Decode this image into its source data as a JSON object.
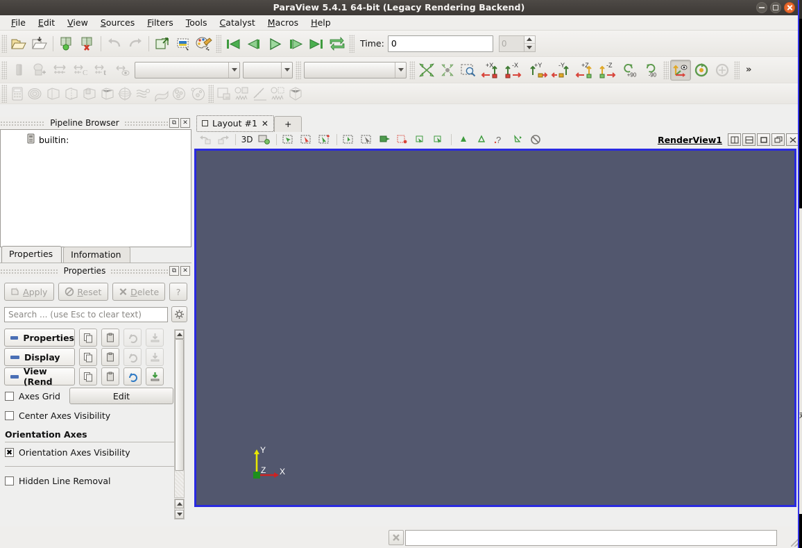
{
  "window": {
    "title": "ParaView 5.4.1 64-bit (Legacy Rendering Backend)",
    "minimize_label": "minimize-icon",
    "maximize_label": "maximize-icon",
    "close_label": "close-icon"
  },
  "menubar": {
    "items": [
      {
        "label": "File",
        "mnemonic": "F"
      },
      {
        "label": "Edit",
        "mnemonic": "E"
      },
      {
        "label": "View",
        "mnemonic": "V"
      },
      {
        "label": "Sources",
        "mnemonic": "S"
      },
      {
        "label": "Filters",
        "mnemonic": "F"
      },
      {
        "label": "Tools",
        "mnemonic": "T"
      },
      {
        "label": "Catalyst",
        "mnemonic": "C"
      },
      {
        "label": "Macros",
        "mnemonic": "M"
      },
      {
        "label": "Help",
        "mnemonic": "H"
      }
    ]
  },
  "toolbars": {
    "main": {
      "buttons": [
        {
          "name": "open-file-icon",
          "tip": "Open"
        },
        {
          "name": "recent-files-icon",
          "tip": "Recent Files"
        },
        {
          "name": "save-state-icon",
          "tip": "Save State"
        },
        {
          "name": "load-state-icon",
          "tip": "Load State"
        },
        {
          "name": "undo-icon",
          "tip": "Undo"
        },
        {
          "name": "redo-icon",
          "tip": "Redo"
        },
        {
          "name": "connect-server-icon",
          "tip": "Connect"
        },
        {
          "name": "screenshot-icon",
          "tip": "Save Screenshot"
        },
        {
          "name": "color-palette-icon",
          "tip": "Edit Color Palette"
        }
      ]
    },
    "vcr": {
      "buttons": [
        {
          "name": "first-frame-icon",
          "tip": "First Frame"
        },
        {
          "name": "previous-frame-icon",
          "tip": "Previous Frame"
        },
        {
          "name": "play-icon",
          "tip": "Play"
        },
        {
          "name": "next-frame-icon",
          "tip": "Next Frame"
        },
        {
          "name": "last-frame-icon",
          "tip": "Last Frame"
        },
        {
          "name": "loop-icon",
          "tip": "Loop"
        }
      ]
    },
    "time": {
      "label": "Time:",
      "value": "0",
      "frame_index": "0",
      "frame_enabled": false
    },
    "representation": {
      "active_array": "",
      "array_component": "",
      "representation_type": "",
      "buttons": [
        {
          "name": "solid-color-icon",
          "tip": "Solid Color"
        },
        {
          "name": "edit-color-map-icon",
          "tip": "Edit Color Map"
        },
        {
          "name": "rescale-to-data-range-icon",
          "tip": "Rescale to Data Range"
        },
        {
          "name": "rescale-custom-range-icon",
          "tip": "Rescale to Custom Range"
        },
        {
          "name": "rescale-over-time-icon",
          "tip": "Rescale over Time"
        },
        {
          "name": "rescale-visible-range-icon",
          "tip": "Rescale to Visible Range"
        }
      ]
    },
    "camera": {
      "buttons": [
        {
          "name": "reset-camera-icon",
          "tip": "Reset Camera"
        },
        {
          "name": "zoom-to-data-icon",
          "tip": "Zoom to Data"
        },
        {
          "name": "rubber-band-zoom-icon",
          "tip": "Rubber Band Zoom"
        }
      ],
      "axis_buttons": [
        {
          "name": "camera-plus-x-icon",
          "label": "+X"
        },
        {
          "name": "camera-minus-x-icon",
          "label": "-X"
        },
        {
          "name": "camera-plus-y-icon",
          "label": "+Y"
        },
        {
          "name": "camera-minus-y-icon",
          "label": "-Y"
        },
        {
          "name": "camera-plus-z-icon",
          "label": "+Z"
        },
        {
          "name": "camera-minus-z-icon",
          "label": "-Z"
        }
      ],
      "rotate_buttons": [
        {
          "name": "rotate-plus-90-icon",
          "label": "+90"
        },
        {
          "name": "rotate-minus-90-icon",
          "label": "-90"
        }
      ],
      "mode_buttons": [
        {
          "name": "show-center-axes-icon",
          "active": true
        },
        {
          "name": "reset-center-icon",
          "active": false
        },
        {
          "name": "pick-center-icon",
          "active": false
        }
      ],
      "overflow_label": "»"
    },
    "filters": {
      "buttons": [
        {
          "name": "calculator-filter-icon",
          "tip": "Calculator"
        },
        {
          "name": "contour-filter-icon",
          "tip": "Contour"
        },
        {
          "name": "clip-filter-icon",
          "tip": "Clip"
        },
        {
          "name": "slice-filter-icon",
          "tip": "Slice"
        },
        {
          "name": "threshold-filter-icon",
          "tip": "Threshold"
        },
        {
          "name": "extract-subset-filter-icon",
          "tip": "Extract Subset"
        },
        {
          "name": "glyph-filter-icon",
          "tip": "Glyph"
        },
        {
          "name": "stream-tracer-filter-icon",
          "tip": "Stream Tracer"
        },
        {
          "name": "warp-filter-icon",
          "tip": "Warp By Vector"
        },
        {
          "name": "group-datasets-filter-icon",
          "tip": "Group Datasets"
        },
        {
          "name": "extract-level-filter-icon",
          "tip": "Extract Level"
        }
      ],
      "data_buttons": [
        {
          "name": "spreadsheet-view-icon",
          "tip": "Spreadsheet View"
        },
        {
          "name": "plot-over-time-icon",
          "tip": "Plot Data Over Time"
        },
        {
          "name": "plot-over-line-icon",
          "tip": "Plot Over Line"
        },
        {
          "name": "plot-selection-over-time-icon",
          "tip": "Plot Selection Over Time"
        },
        {
          "name": "extract-block-icon",
          "tip": "Extract Block"
        }
      ]
    }
  },
  "pipeline_browser": {
    "title": "Pipeline Browser",
    "undock_label": "undock-icon",
    "close_label": "close-icon",
    "items": [
      {
        "label": "builtin:",
        "icon": "server-icon"
      }
    ]
  },
  "properties_panel": {
    "tabs": [
      {
        "label": "Properties",
        "active": true
      },
      {
        "label": "Information",
        "active": false
      }
    ],
    "title": "Properties",
    "undock_label": "undock-icon",
    "close_label": "close-icon",
    "buttons": [
      {
        "label": "Apply",
        "mnemonic": "A",
        "name": "apply-button",
        "enabled": false
      },
      {
        "label": "Reset",
        "mnemonic": "R",
        "name": "reset-button",
        "enabled": false
      },
      {
        "label": "Delete",
        "mnemonic": "D",
        "name": "delete-button",
        "enabled": false
      }
    ],
    "help_label": "?",
    "search": {
      "placeholder": "Search ... (use Esc to clear text)",
      "value": ""
    },
    "gear_label": "gear-icon",
    "sections": [
      {
        "label": "Properties",
        "name": "section-properties",
        "actions": [
          {
            "name": "copy-properties-icon",
            "enabled": true
          },
          {
            "name": "paste-properties-icon",
            "enabled": true
          },
          {
            "name": "restore-defaults-icon",
            "enabled": false
          },
          {
            "name": "save-as-defaults-icon",
            "enabled": false
          }
        ]
      },
      {
        "label": "Display",
        "name": "section-display",
        "actions": [
          {
            "name": "copy-properties-icon",
            "enabled": true
          },
          {
            "name": "paste-properties-icon",
            "enabled": true
          },
          {
            "name": "restore-defaults-icon",
            "enabled": false
          },
          {
            "name": "save-as-defaults-icon",
            "enabled": false
          }
        ]
      },
      {
        "label": "View (Rend",
        "name": "section-view",
        "actions": [
          {
            "name": "copy-properties-icon",
            "enabled": true
          },
          {
            "name": "paste-properties-icon",
            "enabled": true
          },
          {
            "name": "restore-defaults-icon",
            "enabled": true
          },
          {
            "name": "save-as-defaults-icon",
            "enabled": true
          }
        ]
      }
    ],
    "view_properties": {
      "axes_grid": {
        "label": "Axes Grid",
        "checked": false,
        "edit_label": "Edit"
      },
      "center_axes_visibility": {
        "label": "Center Axes Visibility",
        "checked": false
      },
      "orientation_axes_group": "Orientation Axes",
      "orientation_axes_visibility": {
        "label": "Orientation Axes Visibility",
        "checked": true
      },
      "hidden_line_removal": {
        "label": "Hidden Line Removal",
        "checked": false
      }
    }
  },
  "layout": {
    "tabs": [
      {
        "label": "Layout #1",
        "active": true,
        "closable": true
      },
      {
        "label": "+",
        "active": false,
        "closable": false
      }
    ],
    "view_toolbar": {
      "buttons": [
        {
          "name": "undo-camera-icon"
        },
        {
          "name": "redo-camera-icon"
        },
        {
          "name": "interaction-mode-3d-label",
          "label": "3D"
        },
        {
          "name": "camera-link-icon"
        },
        {
          "name": "select-cells-on-icon"
        },
        {
          "name": "select-points-on-icon"
        },
        {
          "name": "select-cells-through-icon"
        },
        {
          "name": "select-points-through-icon"
        },
        {
          "name": "select-block-icon"
        },
        {
          "name": "interactive-select-cells-icon"
        },
        {
          "name": "interactive-select-points-icon"
        },
        {
          "name": "hover-cells-icon"
        },
        {
          "name": "hover-points-icon"
        },
        {
          "name": "select-cells-polygon-icon"
        },
        {
          "name": "select-points-polygon-icon"
        },
        {
          "name": "freeze-selection-icon"
        },
        {
          "name": "grow-selection-icon"
        },
        {
          "name": "shrink-selection-icon"
        },
        {
          "name": "query-selection-icon"
        },
        {
          "name": "extract-selection-icon"
        },
        {
          "name": "clear-selection-icon"
        }
      ]
    }
  },
  "render_view": {
    "title": "RenderView1",
    "active": true,
    "background_color": "#52576e",
    "border_color": "#2a2ae0",
    "buttons": [
      {
        "name": "split-horizontal-button"
      },
      {
        "name": "split-vertical-button"
      },
      {
        "name": "maximize-button"
      },
      {
        "name": "undock-button"
      },
      {
        "name": "close-button"
      }
    ],
    "orientation_axes": {
      "visible": true,
      "x_label": "X",
      "y_label": "Y",
      "z_label": "Z",
      "x_color": "#cc2222",
      "y_color": "#e8e800",
      "z_color": "#1d8f1d"
    }
  },
  "status_bar": {
    "cancel_label": "cancel-icon",
    "message": ""
  }
}
